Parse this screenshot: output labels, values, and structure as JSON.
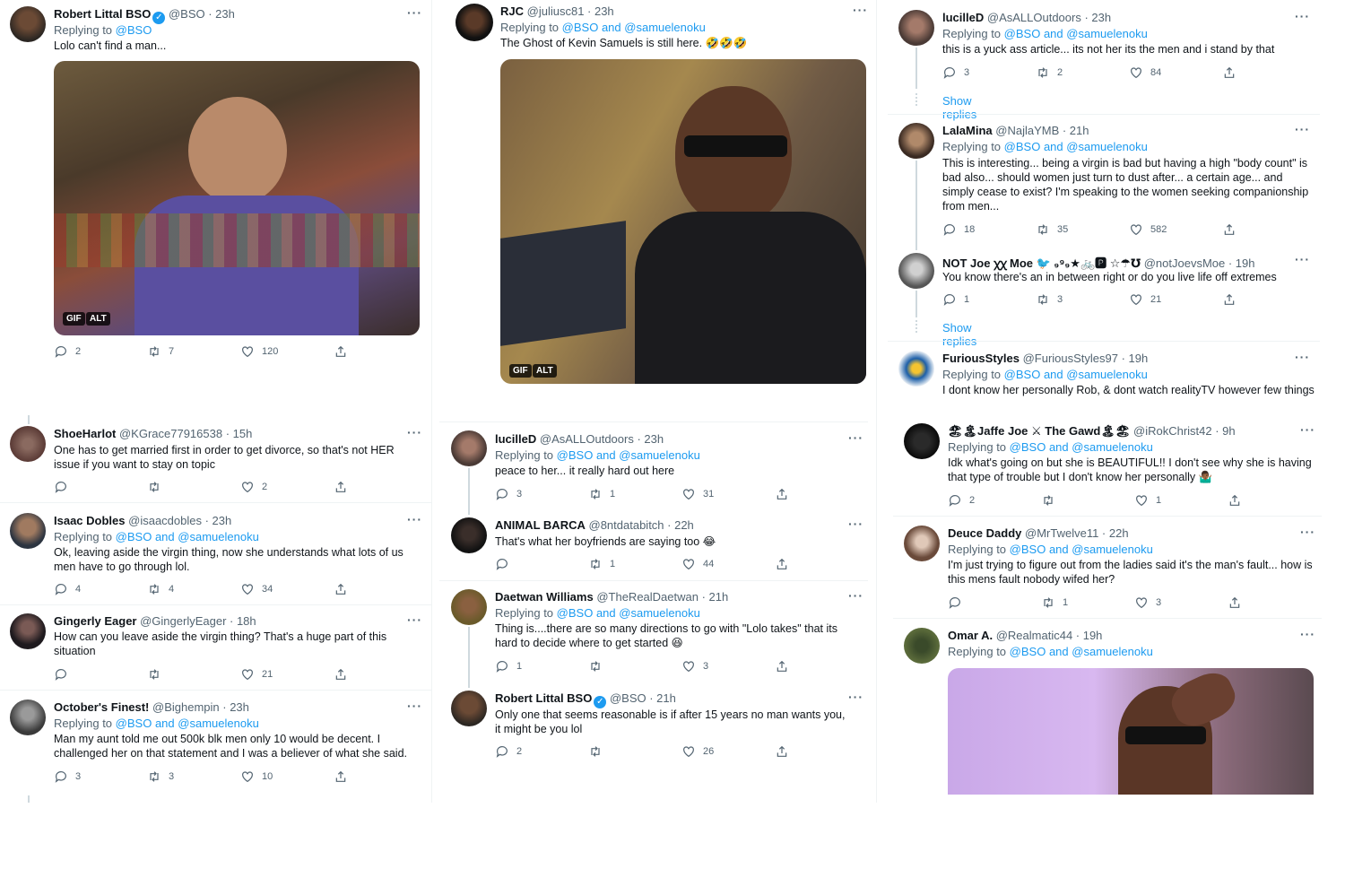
{
  "labels": {
    "replying_to": "Replying to",
    "and": "and",
    "show_replies": "Show replies",
    "gif": "GIF",
    "alt": "ALT"
  },
  "tweets": {
    "t1": {
      "name": "Robert Littal BSO",
      "handle": "@BSO · 23h",
      "to1": "@BSO",
      "text": "Lolo can't find a man...",
      "replies": "2",
      "retweets": "7",
      "likes": "120"
    },
    "t2": {
      "name": "RJC",
      "handle": "@juliusc81 · 23h",
      "to1": "@BSO",
      "to2": "@samuelenoku",
      "text": "The Ghost of Kevin Samuels is still here. 🤣🤣🤣"
    },
    "t3": {
      "name": "lucilleD",
      "handle": "@AsALLOutdoors · 23h",
      "to1": "@BSO",
      "to2": "@samuelenoku",
      "text": "this is a yuck ass article... its not her its the men and i stand by that",
      "replies": "3",
      "retweets": "2",
      "likes": "84"
    },
    "t4": {
      "name": "LalaMina",
      "handle": "@NajlaYMB · 21h",
      "to1": "@BSO",
      "to2": "@samuelenoku",
      "text": "This is interesting... being a virgin is bad but having a high \"body count\" is bad also... should women just turn to dust after... a certain age... and simply cease to exist? I'm speaking to the women seeking companionship from men...",
      "replies": "18",
      "retweets": "35",
      "likes": "582"
    },
    "t5": {
      "name": "NOT Joe ꭓꭓ Moe 🐦 ₉⁹₉★🚲🅿 ☆☂℧",
      "handle": "@notJoevsMoe · 19h",
      "text": "You know there's an in between right or do you live life off extremes",
      "replies": "1",
      "retweets": "3",
      "likes": "21"
    },
    "t6": {
      "name": "FuriousStyles",
      "handle": "@FuriousStyles97 · 19h",
      "to1": "@BSO",
      "to2": "@samuelenoku",
      "text": "I dont know her personally Rob, & dont watch realityTV however few things"
    },
    "t7": {
      "name": "ShoeHarlot",
      "handle": "@KGrace77916538 · 15h",
      "text": "One has to get married first in order to get divorce, so that's not HER issue if you want to stay on topic",
      "likes": "2"
    },
    "t8": {
      "name": "Isaac Dobles",
      "handle": "@isaacdobles · 23h",
      "to1": "@BSO",
      "to2": "@samuelenoku",
      "text": "Ok, leaving aside the virgin thing, now she understands what lots of us men have to go through lol.",
      "replies": "4",
      "retweets": "4",
      "likes": "34"
    },
    "t9": {
      "name": "Gingerly Eager",
      "handle": "@GingerlyEager · 18h",
      "text": "How can you leave aside the virgin thing? That's a huge part of this situation",
      "likes": "21"
    },
    "t10": {
      "name": "October's Finest!",
      "handle": "@Bighempin · 23h",
      "to1": "@BSO",
      "to2": "@samuelenoku",
      "text": "Man my aunt told me out 500k blk men only 10 would be decent. I challenged her on that statement and I was a believer of what she said.",
      "replies": "3",
      "retweets": "3",
      "likes": "10"
    },
    "t11": {
      "name": "lucilleD",
      "handle": "@AsALLOutdoors · 23h",
      "to1": "@BSO",
      "to2": "@samuelenoku",
      "text": "peace to her... it really hard out here",
      "replies": "3",
      "retweets": "1",
      "likes": "31"
    },
    "t12": {
      "name": "ANIMAL BARCA",
      "handle": "@8ntdatabitch · 22h",
      "text": "That's what her boyfriends are saying too 😂",
      "retweets": "1",
      "likes": "44"
    },
    "t13": {
      "name": "Daetwan Williams",
      "handle": "@TheRealDaetwan · 21h",
      "to1": "@BSO",
      "to2": "@samuelenoku",
      "text": "Thing is....there are so many directions to go with \"Lolo takes\" that its hard to decide where to get started 😆",
      "replies": "1",
      "likes": "3"
    },
    "t14": {
      "name": "Robert Littal BSO",
      "handle": "@BSO · 21h",
      "text": "Only one that seems reasonable is if after 15 years no man wants you, it might be you lol",
      "replies": "2",
      "likes": "26"
    },
    "t15": {
      "name": "🏖🏝Jaffe Joe ⚔ The Gawd🏝🏖",
      "handle": "@iRokChrist42 · 9h",
      "to1": "@BSO",
      "to2": "@samuelenoku",
      "text": "Idk what's going on but she is BEAUTIFUL!! I don't see why she is having that type of trouble but I don't know her personally 🤷🏾‍♂️",
      "replies": "2",
      "likes": "1"
    },
    "t16": {
      "name": "Deuce Daddy",
      "handle": "@MrTwelve11 · 22h",
      "to1": "@BSO",
      "to2": "@samuelenoku",
      "text": "I'm just trying to figure out from the ladies said it's the man's fault... how is this mens fault nobody wifed her?",
      "retweets": "1",
      "likes": "3"
    },
    "t17": {
      "name": "Omar A.",
      "handle": "@Realmatic44 · 19h",
      "to1": "@BSO",
      "to2": "@samuelenoku"
    }
  },
  "colors": {
    "link": "#1d9bf0",
    "secondary": "#536471",
    "text": "#0f1419"
  },
  "icons": [
    "reply-icon",
    "retweet-icon",
    "like-icon",
    "share-icon",
    "more-icon",
    "verified-icon"
  ]
}
